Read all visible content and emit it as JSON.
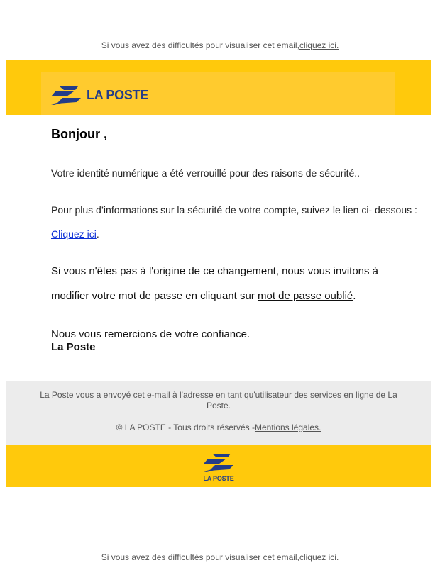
{
  "preheader": {
    "text": "Si vous avez des difficultés pour visualiser cet email,",
    "link": "cliquez ici."
  },
  "header": {
    "logo_text": "LA POSTE",
    "logo_icon": "la-poste-bird-logo",
    "band_color": "#ffc90c",
    "brand_blue": "#233d88"
  },
  "body": {
    "greeting": "Bonjour ,",
    "p1": "Votre identité numérique a été verrouillé pour des raisons de sécurité..",
    "p2": "Pour plus d’informations sur la sécurité de votre compte, suivez le lien ci- dessous :",
    "p3_link": "Cliquez ici",
    "p3_after": ".",
    "p4": "Si vous n'êtes pas à l'origine de ce changement, nous vous invitons à",
    "p5_before": "modifier votre mot de passe en cliquant sur ",
    "p5_link": "mot de passe oublié",
    "p5_after": ".",
    "p6": "Nous vous remercions de votre confiance.",
    "signature": "La Poste"
  },
  "footer": {
    "line1": "La Poste vous a envoyé cet e-mail à l'adresse en tant qu'utilisateur des services en ligne de La Poste.",
    "line2_text": "© LA POSTE - Tous droits réservés -",
    "line2_link": "Mentions légales.",
    "logo_text": "LA POSTE"
  },
  "bottom_note": {
    "text": "Si vous avez des difficultés pour visualiser cet email,",
    "link": "cliquez ici."
  }
}
